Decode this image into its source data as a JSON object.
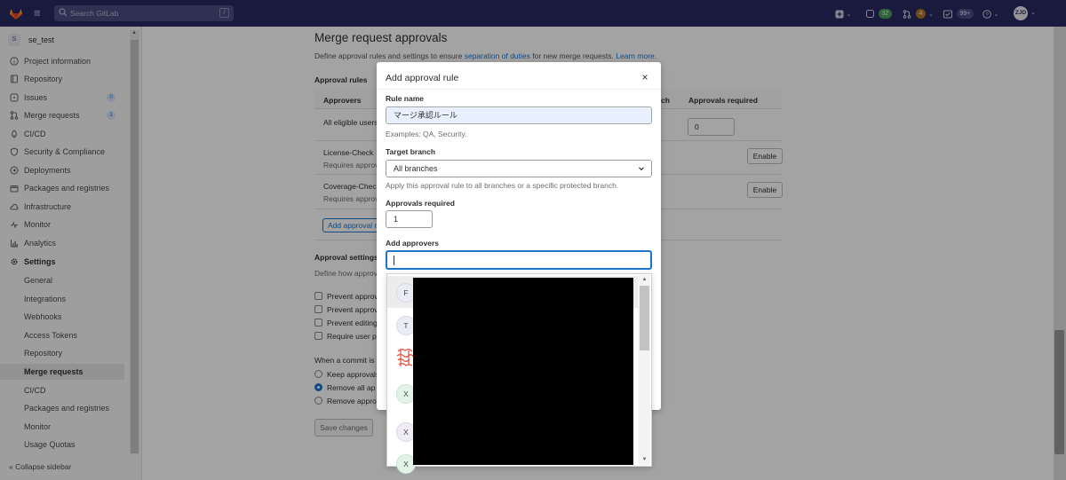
{
  "header": {
    "search_placeholder": "Search GitLab",
    "search_shortcut": "/",
    "issues_count": "32",
    "mr_count": "4",
    "todo_count": "99+",
    "user_initials": "ZJD"
  },
  "sidebar": {
    "project_initial": "S",
    "project_name": "se_test",
    "items": [
      {
        "label": "Project information",
        "icon": "info-icon"
      },
      {
        "label": "Repository",
        "icon": "book-icon"
      },
      {
        "label": "Issues",
        "icon": "issues-icon",
        "badge": "0"
      },
      {
        "label": "Merge requests",
        "icon": "merge-request-icon",
        "badge": "1"
      },
      {
        "label": "CI/CD",
        "icon": "rocket-icon"
      },
      {
        "label": "Security & Compliance",
        "icon": "shield-icon"
      },
      {
        "label": "Deployments",
        "icon": "deployments-icon"
      },
      {
        "label": "Packages and registries",
        "icon": "package-icon"
      },
      {
        "label": "Infrastructure",
        "icon": "cloud-icon"
      },
      {
        "label": "Monitor",
        "icon": "monitor-icon"
      },
      {
        "label": "Analytics",
        "icon": "chart-icon"
      },
      {
        "label": "Settings",
        "icon": "gear-icon"
      }
    ],
    "settings_sub": [
      "General",
      "Integrations",
      "Webhooks",
      "Access Tokens",
      "Repository",
      "Merge requests",
      "CI/CD",
      "Packages and registries",
      "Monitor",
      "Usage Quotas"
    ],
    "collapse_label": "Collapse sidebar"
  },
  "main": {
    "title": "Merge request approvals",
    "desc_prefix": "Define approval rules and settings to ensure ",
    "desc_link": "separation of duties",
    "desc_suffix": " for new merge requests. ",
    "learn_more": "Learn more.",
    "approval_rules_label": "Approval rules",
    "col_approvers": "Approvers",
    "col_branch_fragment": "ch",
    "col_required": "Approvals required",
    "all_eligible": "All eligible users",
    "eligible_required_value": "0",
    "license_check": "License-Check",
    "license_sub": "Requires approval",
    "coverage_check": "Coverage-Check",
    "coverage_sub": "Requires approval",
    "enable_label": "Enable",
    "add_rule_btn": "Add approval rule",
    "approval_settings_label": "Approval settings",
    "settings_desc": "Define how approval rules are applied",
    "checkboxes": [
      "Prevent approval",
      "Prevent approval",
      "Prevent editing",
      "Require user p"
    ],
    "commit_label": "When a commit is",
    "radios": [
      "Keep approvals",
      "Remove all ap",
      "Remove appro"
    ],
    "save_btn": "Save changes"
  },
  "modal": {
    "title": "Add approval rule",
    "close": "×",
    "rule_name_label": "Rule name",
    "rule_name_value": "マージ承認ルール",
    "rule_name_help": "Examples: QA, Security.",
    "target_branch_label": "Target branch",
    "target_branch_value": "All branches",
    "target_branch_help": "Apply this approval rule to all branches or a specific protected branch.",
    "approvals_required_label": "Approvals required",
    "approvals_required_value": "1",
    "add_approvers_label": "Add approvers",
    "dropdown_initials": [
      "F",
      "T",
      "X",
      "X",
      "X"
    ]
  },
  "colors": {
    "topbar": "#292961",
    "link": "#1f75cb",
    "focus": "#1f75cb"
  }
}
